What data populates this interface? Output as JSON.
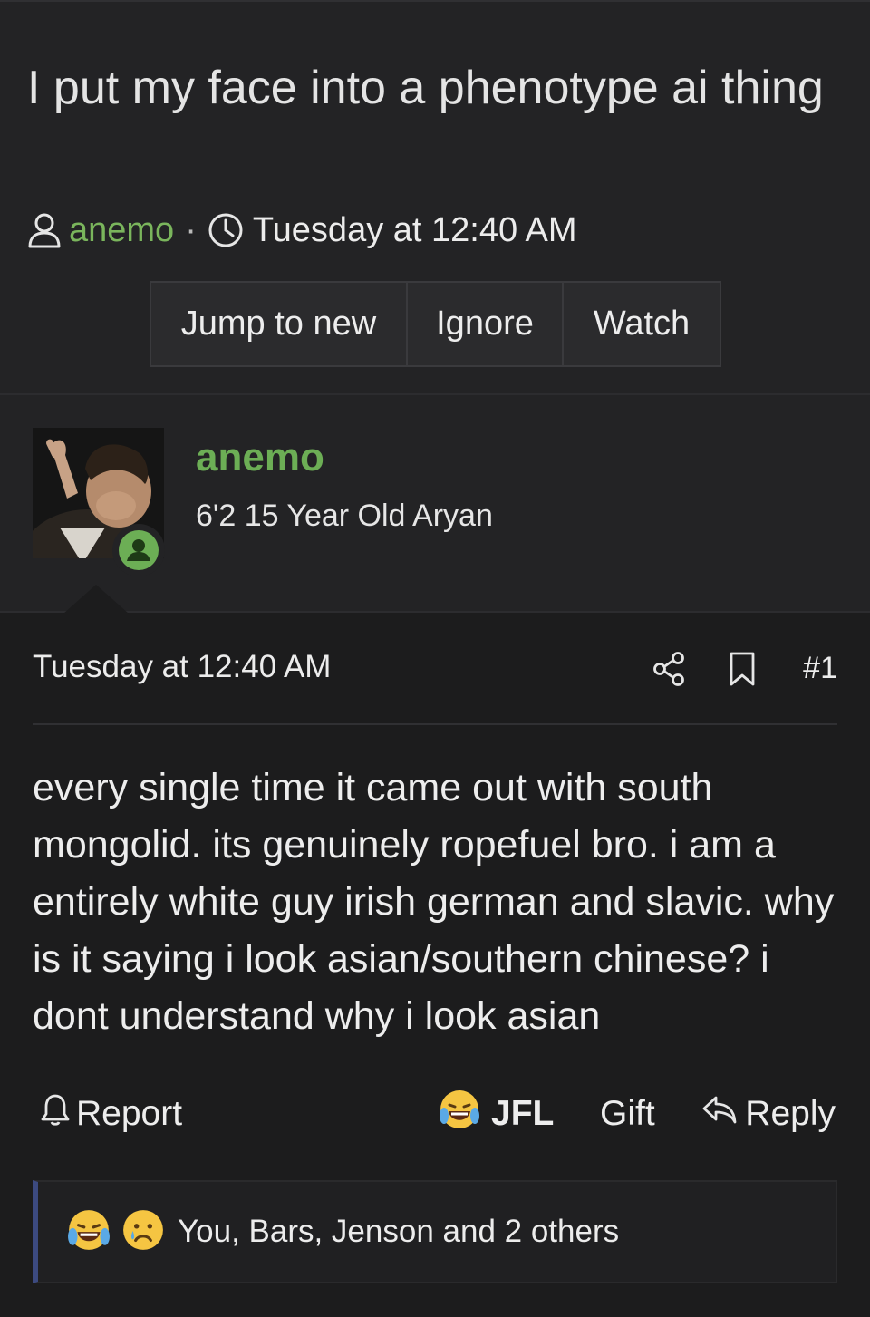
{
  "thread": {
    "title": "I put my face into a phenotype ai thing",
    "author": "anemo",
    "separator": "·",
    "date": "Tuesday at 12:40 AM"
  },
  "buttons": {
    "jump": "Jump to new",
    "ignore": "Ignore",
    "watch": "Watch"
  },
  "post": {
    "username": "anemo",
    "user_title": "6'2 15 Year Old Aryan",
    "date": "Tuesday at 12:40 AM",
    "number": "#1",
    "body": "every single time it came out with south mongolid. its genuinely ropefuel bro. i am a entirely white guy irish german and slavic. why is it saying i look asian/southern chinese? i dont understand why i look asian"
  },
  "actions": {
    "report": "Report",
    "reaction": "JFL",
    "gift": "Gift",
    "reply": "Reply"
  },
  "reactions": {
    "summary": "You, Bars, Jenson and 2 others"
  },
  "colors": {
    "accent_green": "#6cae55",
    "reaction_bar": "#3c4a80",
    "background": "#1c1c1d",
    "panel": "#232325"
  },
  "icons": [
    "user-icon",
    "clock-icon",
    "online-status-icon",
    "share-icon",
    "bookmark-icon",
    "bell-icon",
    "laughing-crying-emoji",
    "sad-crying-emoji",
    "reply-arrow-icon"
  ]
}
